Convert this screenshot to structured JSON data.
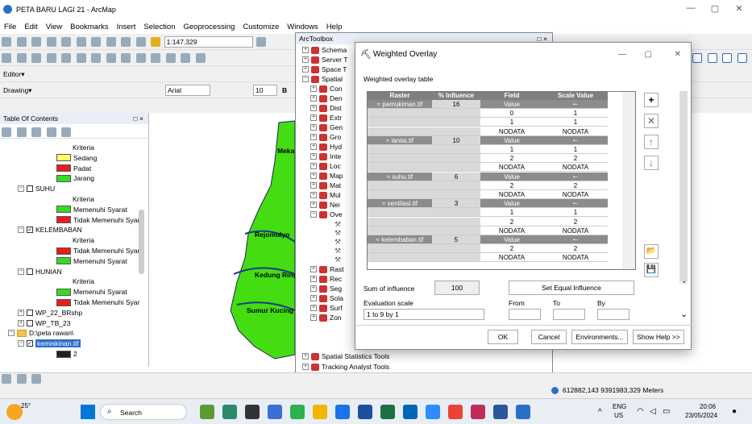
{
  "window": {
    "title": "PETA BARU LAGI 21 - ArcMap",
    "minimize": "—",
    "restore": "▢",
    "close": "✕"
  },
  "menu": [
    "File",
    "Edit",
    "View",
    "Bookmarks",
    "Insert",
    "Selection",
    "Geoprocessing",
    "Customize",
    "Windows",
    "Help"
  ],
  "toolbar": {
    "scale": "1:147.329",
    "editor_label": "Editor▾",
    "drawing_label": "Drawing▾",
    "font_name": "Arial",
    "font_size": "10",
    "bold": "B"
  },
  "toc": {
    "title": "Table Of Contents",
    "close": "□ ×",
    "items": [
      {
        "label": "Kriteria",
        "type": "text"
      },
      {
        "label": "Sedang",
        "type": "swatch",
        "color": "#ffff66"
      },
      {
        "label": "Padat",
        "type": "swatch",
        "color": "#e81c1c"
      },
      {
        "label": "Jarang",
        "type": "swatch",
        "color": "#33dd22"
      },
      {
        "label": "SUHU",
        "type": "layer",
        "checked": false
      },
      {
        "label": "Kriteria",
        "type": "text"
      },
      {
        "label": "Memenuhi Syarat",
        "type": "swatch",
        "color": "#33dd22"
      },
      {
        "label": "Tidak Memenuhi Syar",
        "type": "swatch",
        "color": "#e81c1c"
      },
      {
        "label": "KELEMBABAN",
        "type": "layer",
        "checked": true
      },
      {
        "label": "Kriteria",
        "type": "text"
      },
      {
        "label": "Tidak Memenuhi Syar",
        "type": "swatch",
        "color": "#e81c1c"
      },
      {
        "label": "Memenuhi Syarat",
        "type": "swatch",
        "color": "#33dd22"
      },
      {
        "label": "HUNIAN",
        "type": "layer",
        "checked": false
      },
      {
        "label": "Kriteria",
        "type": "text"
      },
      {
        "label": "Memenuhi Syarat",
        "type": "swatch",
        "color": "#33dd22"
      },
      {
        "label": "Tidak Memenuhi Syar",
        "type": "swatch",
        "color": "#e81c1c"
      },
      {
        "label": "WP_22_BRshp",
        "type": "layer",
        "checked": false
      },
      {
        "label": "WP_TB_23",
        "type": "layer",
        "checked": false
      },
      {
        "label": "D:\\peta rawan\\",
        "type": "folder"
      },
      {
        "label": "kemiskinan.tif",
        "type": "layer-selected",
        "checked": true
      },
      {
        "label": "2",
        "type": "swatch",
        "color": "#222222"
      }
    ]
  },
  "map": {
    "labels": [
      "Meka",
      "Rejomulyo",
      "Kedung Ring",
      "Sumur Kucing"
    ]
  },
  "toolbox": {
    "title": "ArcToolbox",
    "close": "□ ×",
    "items": [
      "Schema",
      "Server T",
      "Space T",
      "Spatial ",
      "Con",
      "Den",
      "Dist",
      "Extr",
      "Gen",
      "Gro",
      "Hyd",
      "Inte",
      "Loc",
      "Map",
      "Mat",
      "Mul",
      "Nei",
      "Ove",
      "Rast",
      "Rec",
      "Seg",
      "Sola",
      "Surf",
      "Zon"
    ],
    "bottom_items": [
      "Spatial Statistics Tools",
      "Tracking Analyst Tools"
    ]
  },
  "dialog": {
    "title": "Weighted Overlay",
    "section_label": "Weighted overlay table",
    "headers": [
      "Raster",
      "% Influence",
      "Field",
      "Scale Value"
    ],
    "rasters": [
      {
        "name": "pemukiman.tif",
        "influence": "16",
        "rows": [
          [
            "Value",
            "↼"
          ],
          [
            "0",
            "1"
          ],
          [
            "1",
            "1"
          ],
          [
            "NODATA",
            "NODATA"
          ]
        ]
      },
      {
        "name": "lantai.tif",
        "influence": "10",
        "rows": [
          [
            "Value",
            "↼"
          ],
          [
            "1",
            "1"
          ],
          [
            "2",
            "2"
          ],
          [
            "NODATA",
            "NODATA"
          ]
        ]
      },
      {
        "name": "suhu.tif",
        "influence": "6",
        "rows": [
          [
            "Value",
            "↼"
          ],
          [
            "2",
            "2"
          ],
          [
            "NODATA",
            "NODATA"
          ]
        ]
      },
      {
        "name": "ventilasi.tif",
        "influence": "3",
        "rows": [
          [
            "Value",
            "↼"
          ],
          [
            "1",
            "1"
          ],
          [
            "2",
            "2"
          ],
          [
            "NODATA",
            "NODATA"
          ]
        ]
      },
      {
        "name": "kelembaban.tif",
        "influence": "5",
        "rows": [
          [
            "Value",
            "↼"
          ],
          [
            "2",
            "2"
          ],
          [
            "NODATA",
            "NODATA"
          ]
        ]
      }
    ],
    "sum_label": "Sum of influence",
    "sum_value": "100",
    "set_equal": "Set Equal Influence",
    "eval_label": "Evaluation scale",
    "eval_value": "1 to 9 by 1",
    "from_label": "From",
    "to_label": "To",
    "by_label": "By",
    "ok": "OK",
    "cancel": "Cancel",
    "environments": "Environments...",
    "show_help": "Show Help >>",
    "side_buttons": [
      "+",
      "✕",
      "↑",
      "↓"
    ]
  },
  "status": {
    "coords": "612882,143  9391983,329 Meters"
  },
  "taskbar": {
    "weather": "25°",
    "search_placeholder": "Search",
    "lang": "ENG",
    "region": "US",
    "time": "20:06",
    "date": "23/05/2024"
  }
}
